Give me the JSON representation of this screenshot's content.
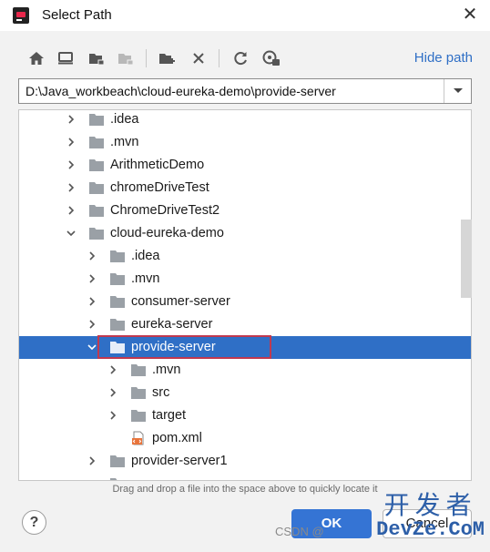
{
  "window": {
    "title": "Select Path"
  },
  "toolbar": {
    "buttons": [
      {
        "icon": "home-icon"
      },
      {
        "icon": "desktop-icon"
      },
      {
        "icon": "project-folder-icon"
      },
      {
        "icon": "module-folder-icon"
      },
      {
        "icon": "new-folder-icon"
      },
      {
        "icon": "delete-icon"
      },
      {
        "icon": "refresh-icon"
      },
      {
        "icon": "show-hidden-icon"
      }
    ],
    "hide_path": "Hide path"
  },
  "path": {
    "value": "D:\\Java_workbeach\\cloud-eureka-demo\\provide-server"
  },
  "tree": {
    "rows": [
      {
        "label": ".idea",
        "depth": 0,
        "chevron": "right",
        "icon": "folder"
      },
      {
        "label": ".mvn",
        "depth": 0,
        "chevron": "right",
        "icon": "folder"
      },
      {
        "label": "ArithmeticDemo",
        "depth": 0,
        "chevron": "right",
        "icon": "folder"
      },
      {
        "label": "chromeDriveTest",
        "depth": 0,
        "chevron": "right",
        "icon": "folder"
      },
      {
        "label": "ChromeDriveTest2",
        "depth": 0,
        "chevron": "right",
        "icon": "folder"
      },
      {
        "label": "cloud-eureka-demo",
        "depth": 0,
        "chevron": "down",
        "icon": "folder"
      },
      {
        "label": ".idea",
        "depth": 1,
        "chevron": "right",
        "icon": "folder"
      },
      {
        "label": ".mvn",
        "depth": 1,
        "chevron": "right",
        "icon": "folder"
      },
      {
        "label": "consumer-server",
        "depth": 1,
        "chevron": "right",
        "icon": "folder"
      },
      {
        "label": "eureka-server",
        "depth": 1,
        "chevron": "right",
        "icon": "folder"
      },
      {
        "label": "provide-server",
        "depth": 1,
        "chevron": "down",
        "icon": "folder",
        "selected": true
      },
      {
        "label": ".mvn",
        "depth": 2,
        "chevron": "right",
        "icon": "folder"
      },
      {
        "label": "src",
        "depth": 2,
        "chevron": "right",
        "icon": "folder"
      },
      {
        "label": "target",
        "depth": 2,
        "chevron": "right",
        "icon": "folder"
      },
      {
        "label": "pom.xml",
        "depth": 2,
        "chevron": "none",
        "icon": "xml-file"
      },
      {
        "label": "provider-server1",
        "depth": 1,
        "chevron": "right",
        "icon": "folder"
      },
      {
        "label": "",
        "depth": 1,
        "chevron": "none",
        "icon": "folder"
      }
    ]
  },
  "hint": "Drag and drop a file into the space above to quickly locate it",
  "buttons": {
    "help": "?",
    "ok": "OK",
    "cancel": "Cancel"
  },
  "watermark": {
    "csdn": "CSDN @",
    "logo_cn": "开发者",
    "logo_en": "DevZe.CoM"
  },
  "colors": {
    "accent": "#2f6fc6",
    "selection_outline": "#c0394f",
    "folder": "#9aa0a6",
    "xml": "#e8743b"
  }
}
